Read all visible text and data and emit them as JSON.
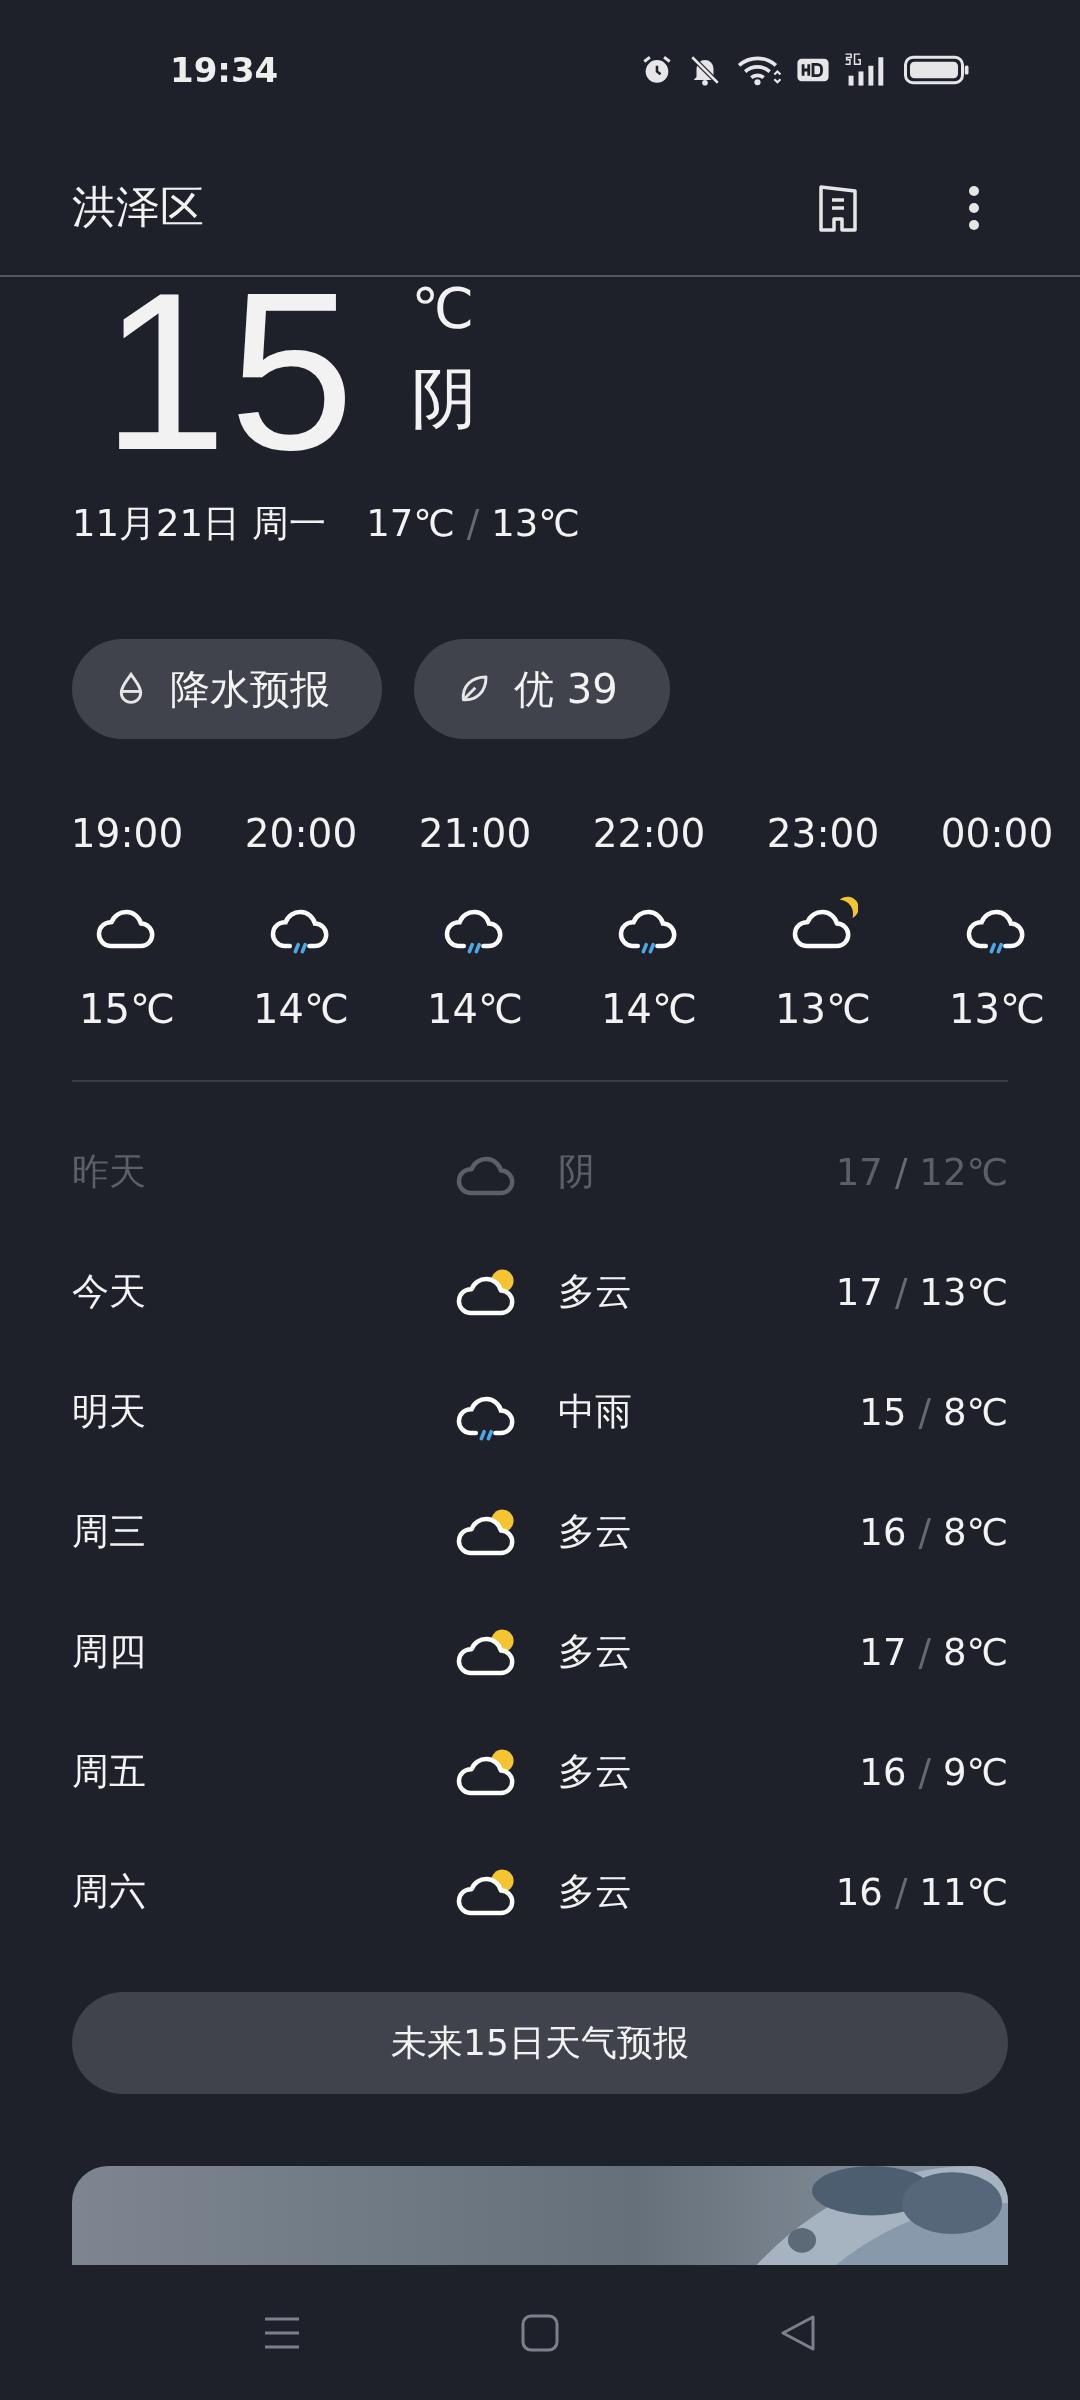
{
  "status_bar": {
    "time": "19:34"
  },
  "header": {
    "location": "洪泽区"
  },
  "current": {
    "temperature": "15",
    "unit": "℃",
    "condition": "阴",
    "date": "11月21日",
    "weekday": "周一",
    "high": "17℃",
    "separator": "/",
    "low": "13℃"
  },
  "chips": [
    {
      "kind": "precipitation",
      "label": "降水预报"
    },
    {
      "kind": "air",
      "label": "优 39"
    }
  ],
  "hourly": [
    {
      "time": "19:00",
      "kind": "cloudy",
      "temp": "15℃"
    },
    {
      "time": "20:00",
      "kind": "rain",
      "temp": "14℃"
    },
    {
      "time": "21:00",
      "kind": "rain",
      "temp": "14℃"
    },
    {
      "time": "22:00",
      "kind": "rain",
      "temp": "14℃"
    },
    {
      "time": "23:00",
      "kind": "cloudy_night",
      "temp": "13℃"
    },
    {
      "time": "00:00",
      "kind": "rain",
      "temp": "13℃"
    }
  ],
  "daily": [
    {
      "day": "昨天",
      "kind": "cloudy",
      "condition": "阴",
      "high": "17",
      "separator": "/",
      "low": "12℃",
      "past": true
    },
    {
      "day": "今天",
      "kind": "cloudy_day",
      "condition": "多云",
      "high": "17",
      "separator": "/",
      "low": "13℃",
      "past": false
    },
    {
      "day": "明天",
      "kind": "rain",
      "condition": "中雨",
      "high": "15",
      "separator": "/",
      "low": "8℃",
      "past": false
    },
    {
      "day": "周三",
      "kind": "cloudy_day",
      "condition": "多云",
      "high": "16",
      "separator": "/",
      "low": "8℃",
      "past": false
    },
    {
      "day": "周四",
      "kind": "cloudy_day",
      "condition": "多云",
      "high": "17",
      "separator": "/",
      "low": "8℃",
      "past": false
    },
    {
      "day": "周五",
      "kind": "cloudy_day",
      "condition": "多云",
      "high": "16",
      "separator": "/",
      "low": "9℃",
      "past": false
    },
    {
      "day": "周六",
      "kind": "cloudy_day",
      "condition": "多云",
      "high": "16",
      "separator": "/",
      "low": "11℃",
      "past": false
    }
  ],
  "forecast_button": "未来15日天气预报"
}
